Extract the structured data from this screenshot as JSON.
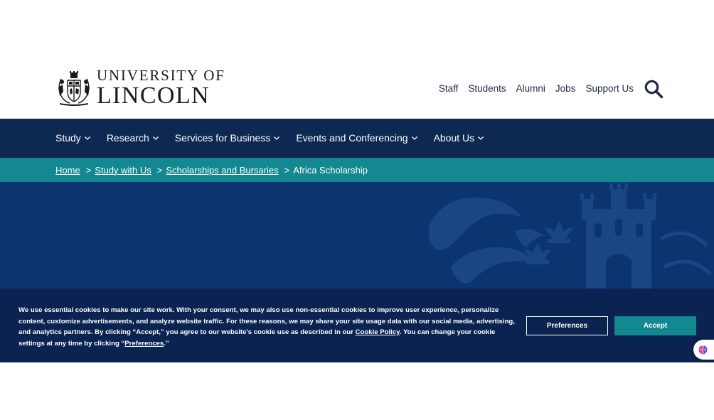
{
  "header": {
    "logo": {
      "line1": "UNIVERSITY OF",
      "line2": "LINCOLN"
    },
    "utility_links": [
      "Staff",
      "Students",
      "Alumni",
      "Jobs",
      "Support Us"
    ],
    "search_icon": "search-icon"
  },
  "main_nav": {
    "items": [
      "Study",
      "Research",
      "Services for Business",
      "Events and Conferencing",
      "About Us"
    ]
  },
  "breadcrumb": {
    "links": [
      "Home",
      "Study with Us",
      "Scholarships and Bursaries"
    ],
    "separator": ">",
    "current": "Africa Scholarship"
  },
  "cookie_banner": {
    "text_part1": "We use essential cookies to make our site work. With your consent, we may also use non-essential cookies to improve user experience, personalize content, customize advertisements, and analyze website traffic. For these reasons, we may share your site usage data with our social media, advertising, and analytics partners. By clicking “Accept,” you agree to our website's cookie use as described in our ",
    "cookie_policy_link": "Cookie Policy",
    "text_part2": ". You can change your cookie settings at any time by clicking “",
    "preferences_link": "Preferences",
    "text_part3": ".”",
    "preferences_button": "Preferences",
    "accept_button": "Accept"
  },
  "colors": {
    "nav_bg": "#0d2851",
    "breadcrumb_bg": "#138890",
    "hero_bg": "#0c3471",
    "banner_bg": "#0a2350",
    "accent": "#138890"
  }
}
